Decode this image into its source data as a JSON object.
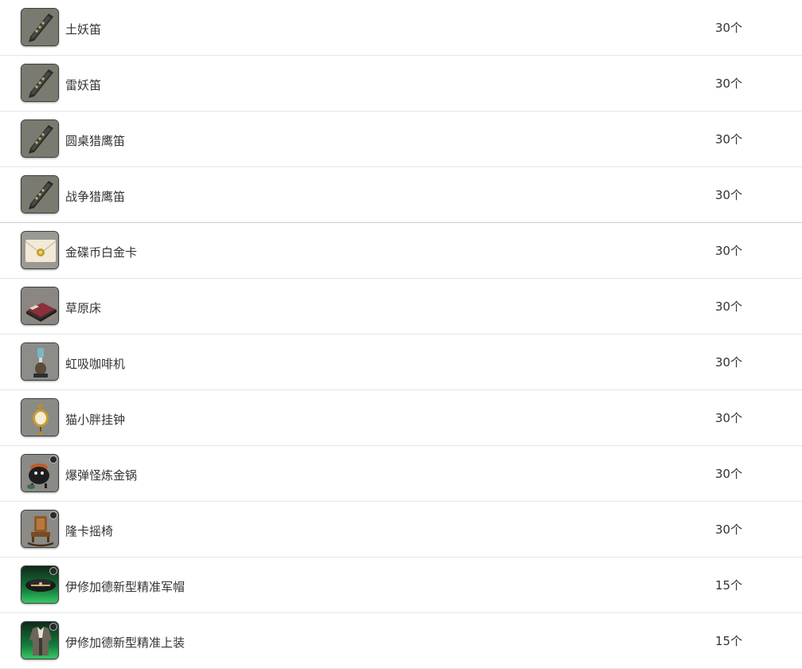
{
  "items": [
    {
      "name": "土妖笛",
      "qty": "30个",
      "icon": "flute-icon"
    },
    {
      "name": "雷妖笛",
      "qty": "30个",
      "icon": "flute-icon"
    },
    {
      "name": "圆桌猎鹰笛",
      "qty": "30个",
      "icon": "flute-icon"
    },
    {
      "name": "战争猎鹰笛",
      "qty": "30个",
      "icon": "flute-icon"
    },
    {
      "name": "金碟币白金卡",
      "qty": "30个",
      "icon": "envelope-card-icon"
    },
    {
      "name": "草原床",
      "qty": "30个",
      "icon": "bed-icon"
    },
    {
      "name": "虹吸咖啡机",
      "qty": "30个",
      "icon": "coffee-siphon-icon"
    },
    {
      "name": "猫小胖挂钟",
      "qty": "30个",
      "icon": "wall-clock-icon"
    },
    {
      "name": "爆弹怪炼金锅",
      "qty": "30个",
      "icon": "cauldron-icon"
    },
    {
      "name": "隆卡摇椅",
      "qty": "30个",
      "icon": "rocking-chair-icon"
    },
    {
      "name": "伊修加德新型精准军帽",
      "qty": "15个",
      "icon": "military-hat-icon"
    },
    {
      "name": "伊修加德新型精准上装",
      "qty": "15个",
      "icon": "coat-icon"
    }
  ]
}
